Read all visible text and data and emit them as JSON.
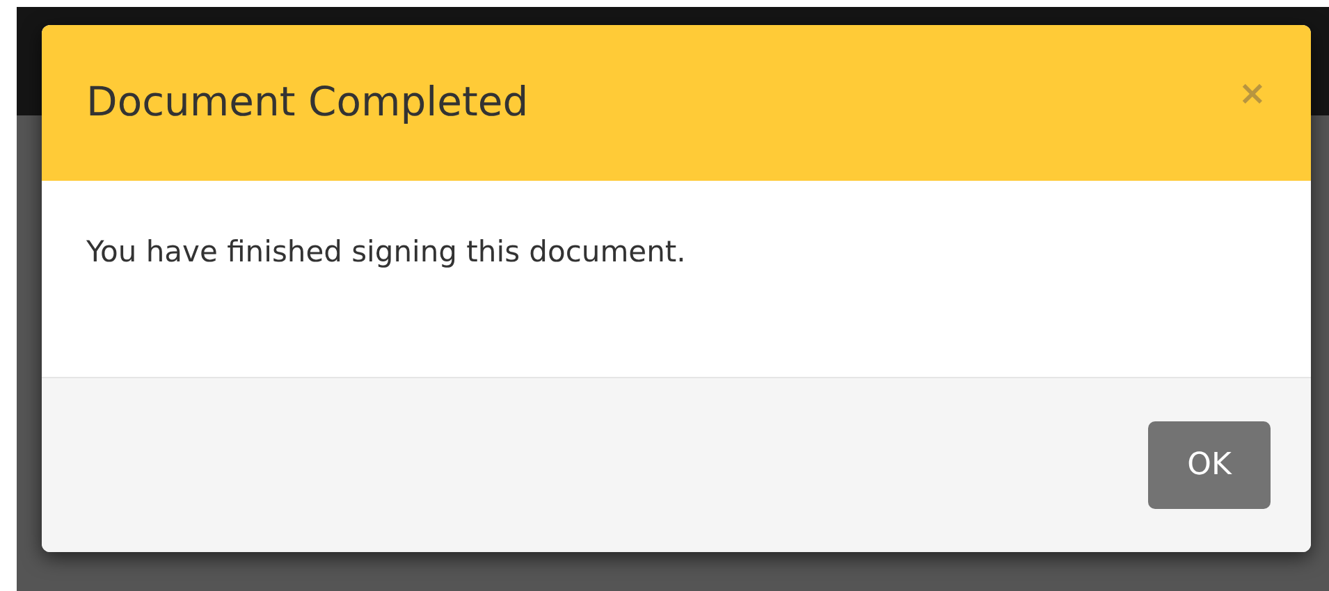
{
  "dialog": {
    "title": "Document Completed",
    "close": "×",
    "message": "You have finished signing this document.",
    "buttons": [
      "OK"
    ]
  }
}
